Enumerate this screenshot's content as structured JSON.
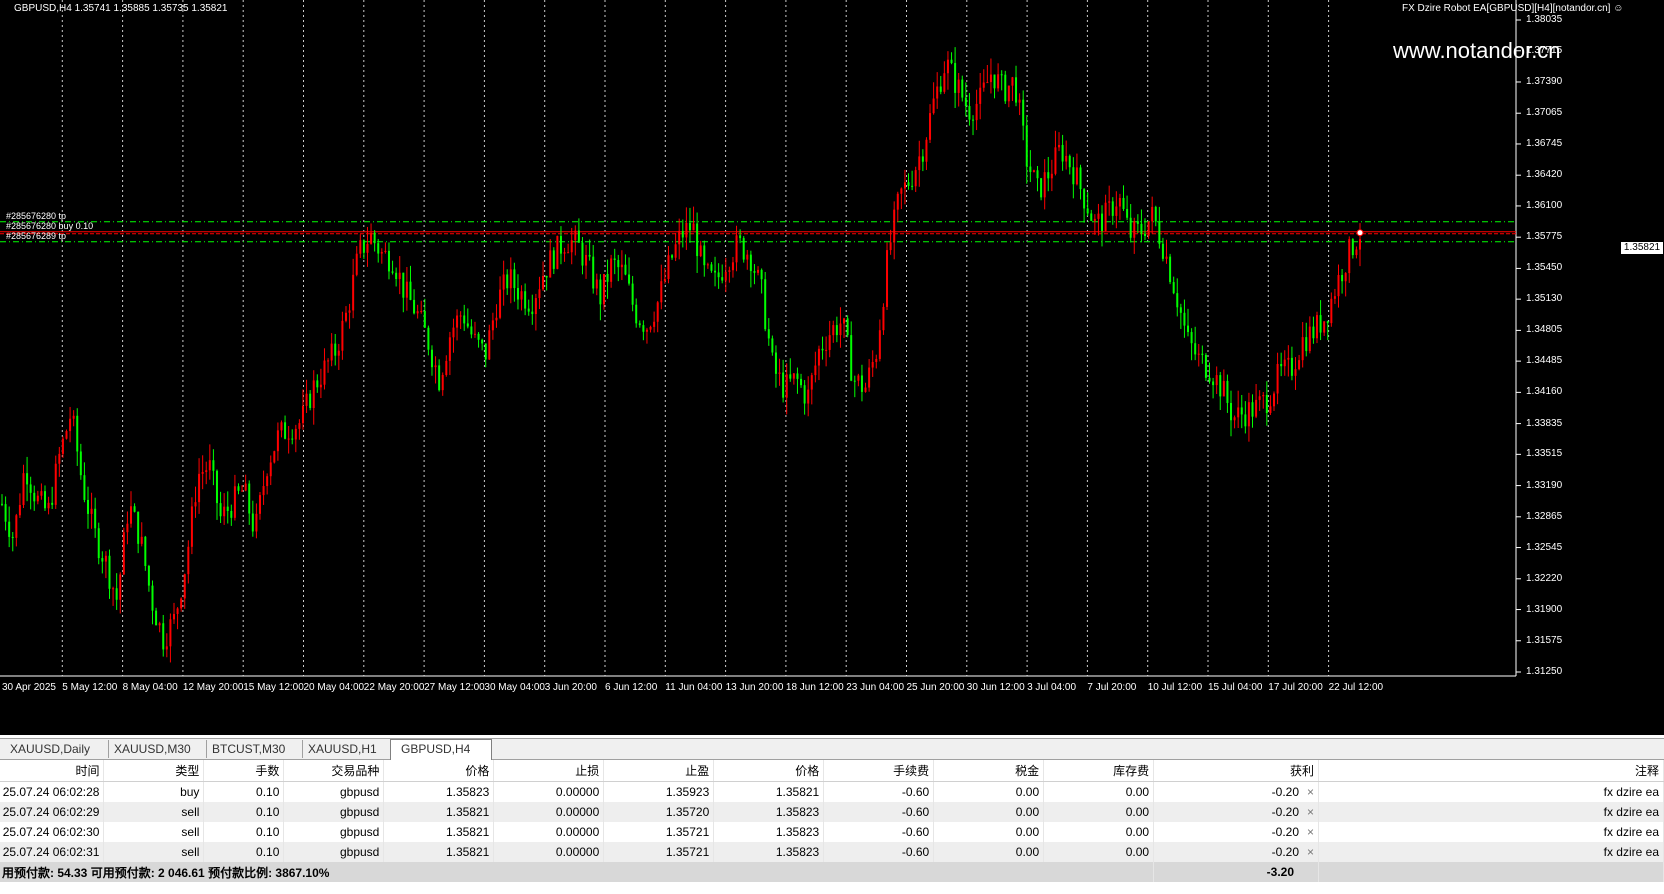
{
  "chart": {
    "header_left": "GBPUSD,H4  1.35741 1.35885 1.35735 1.35821",
    "header_right": "FX Dzire Robot EA[GBPUSD][H4][notandor.cn]",
    "smiley": "☺",
    "watermark": "www.notandor.cn",
    "current_price": "1.35821",
    "order_labels": [
      "#285676280 tp",
      "#285676280 buy 0.10",
      "#285676289 tp"
    ],
    "price_ticks": [
      "1.38035",
      "1.37715",
      "1.37390",
      "1.37065",
      "1.36745",
      "1.36420",
      "1.36100",
      "1.35775",
      "1.35450",
      "1.35130",
      "1.34805",
      "1.34485",
      "1.34160",
      "1.33835",
      "1.33515",
      "1.33190",
      "1.32865",
      "1.32545",
      "1.32220",
      "1.31900",
      "1.31575",
      "1.31250"
    ],
    "time_ticks": [
      "30 Apr 2025",
      "5 May 12:00",
      "8 May 04:00",
      "12 May 20:00",
      "15 May 12:00",
      "20 May 04:00",
      "22 May 20:00",
      "27 May 12:00",
      "30 May 04:00",
      "3 Jun 20:00",
      "6 Jun 12:00",
      "11 Jun 04:00",
      "13 Jun 20:00",
      "18 Jun 12:00",
      "23 Jun 04:00",
      "25 Jun 20:00",
      "30 Jun 12:00",
      "3 Jul 04:00",
      "7 Jul 20:00",
      "10 Jul 12:00",
      "15 Jul 04:00",
      "17 Jul 20:00",
      "22 Jul 12:00"
    ],
    "colors": {
      "bull": "#ff0000",
      "bear": "#00ff00",
      "grid": "#ffffff",
      "level": "#00ff00",
      "price_line": "#ff0000"
    },
    "price_path": [
      1.33,
      1.3265,
      1.334,
      1.3305,
      1.329,
      1.335,
      1.3395,
      1.332,
      1.327,
      1.324,
      1.32,
      1.33,
      1.3265,
      1.32,
      1.316,
      1.318,
      1.324,
      1.333,
      1.334,
      1.3285,
      1.33,
      1.3315,
      1.327,
      1.334,
      1.337,
      1.338,
      1.3385,
      1.342,
      1.344,
      1.346,
      1.35,
      1.356,
      1.358,
      1.356,
      1.3555,
      1.352,
      1.35,
      1.347,
      1.343,
      1.348,
      1.35,
      1.347,
      1.3455,
      1.351,
      1.3535,
      1.352,
      1.351,
      1.354,
      1.356,
      1.3575,
      1.357,
      1.3545,
      1.3515,
      1.355,
      1.354,
      1.35,
      1.3485,
      1.351,
      1.355,
      1.358,
      1.359,
      1.354,
      1.353,
      1.3555,
      1.357,
      1.356,
      1.352,
      1.344,
      1.342,
      1.343,
      1.341,
      1.346,
      1.348,
      1.349,
      1.343,
      1.342,
      1.346,
      1.356,
      1.362,
      1.364,
      1.367,
      1.372,
      1.376,
      1.3735,
      1.371,
      1.372,
      1.375,
      1.373,
      1.374,
      1.366,
      1.3625,
      1.3645,
      1.367,
      1.365,
      1.362,
      1.359,
      1.36,
      1.362,
      1.358,
      1.3585,
      1.36,
      1.3565,
      1.352,
      1.347,
      1.345,
      1.344,
      1.342,
      1.339,
      1.3395,
      1.34,
      1.341,
      1.3435,
      1.344,
      1.347,
      1.348,
      1.3495,
      1.353,
      1.356,
      1.3582
    ]
  },
  "tabs": [
    "XAUUSD,Daily",
    "XAUUSD,M30",
    "BTCUST,M30",
    "XAUUSD,H1",
    "GBPUSD,H4"
  ],
  "table": {
    "headers": [
      "时间",
      "类型",
      "手数",
      "交易品种",
      "价格",
      "止损",
      "止盈",
      "价格",
      "手续费",
      "税金",
      "库存费",
      "获利",
      "注释"
    ],
    "rows": [
      [
        "25.07.24 06:02:28",
        "buy",
        "0.10",
        "gbpusd",
        "1.35823",
        "0.00000",
        "1.35923",
        "1.35821",
        "-0.60",
        "0.00",
        "0.00",
        "-0.20",
        "fx dzire ea"
      ],
      [
        "25.07.24 06:02:29",
        "sell",
        "0.10",
        "gbpusd",
        "1.35821",
        "0.00000",
        "1.35720",
        "1.35823",
        "-0.60",
        "0.00",
        "0.00",
        "-0.20",
        "fx dzire ea"
      ],
      [
        "25.07.24 06:02:30",
        "sell",
        "0.10",
        "gbpusd",
        "1.35821",
        "0.00000",
        "1.35721",
        "1.35823",
        "-0.60",
        "0.00",
        "0.00",
        "-0.20",
        "fx dzire ea"
      ],
      [
        "25.07.24 06:02:31",
        "sell",
        "0.10",
        "gbpusd",
        "1.35821",
        "0.00000",
        "1.35721",
        "1.35823",
        "-0.60",
        "0.00",
        "0.00",
        "-0.20",
        "fx dzire ea"
      ]
    ],
    "close_glyph": "×",
    "summary": {
      "text": "用预付款: 54.33  可用预付款: 2 046.61  预付款比例: 3867.10%",
      "total": "-3.20"
    }
  }
}
